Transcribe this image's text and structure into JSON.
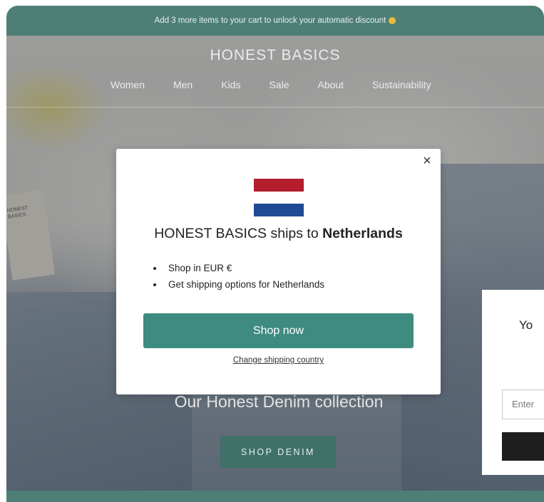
{
  "announcement": {
    "text": "Add 3 more items to your cart to unlock your automatic discount",
    "emoji": "smiling-face-icon"
  },
  "header": {
    "logo": "HONEST BASICS",
    "nav": [
      "Women",
      "Men",
      "Kids",
      "Sale",
      "About",
      "Sustainability"
    ]
  },
  "hero": {
    "tag_text": "HONEST BASICS",
    "title": "Our Honest Denim collection",
    "cta": "SHOP DENIM"
  },
  "side_panel": {
    "heading_fragment": "Yo",
    "input_placeholder": "Enter"
  },
  "modal": {
    "title_prefix": "HONEST BASICS ships to ",
    "country": "Netherlands",
    "bullets": [
      "Shop in EUR €",
      "Get shipping options for Netherlands"
    ],
    "primary_button": "Shop now",
    "secondary_link": "Change shipping country",
    "close_symbol": "×",
    "flag_colors": [
      "#b41d2c",
      "#ffffff",
      "#1f4a93"
    ]
  },
  "colors": {
    "brand_teal": "#3e8b80",
    "announcement_bg": "#4d7f76"
  }
}
